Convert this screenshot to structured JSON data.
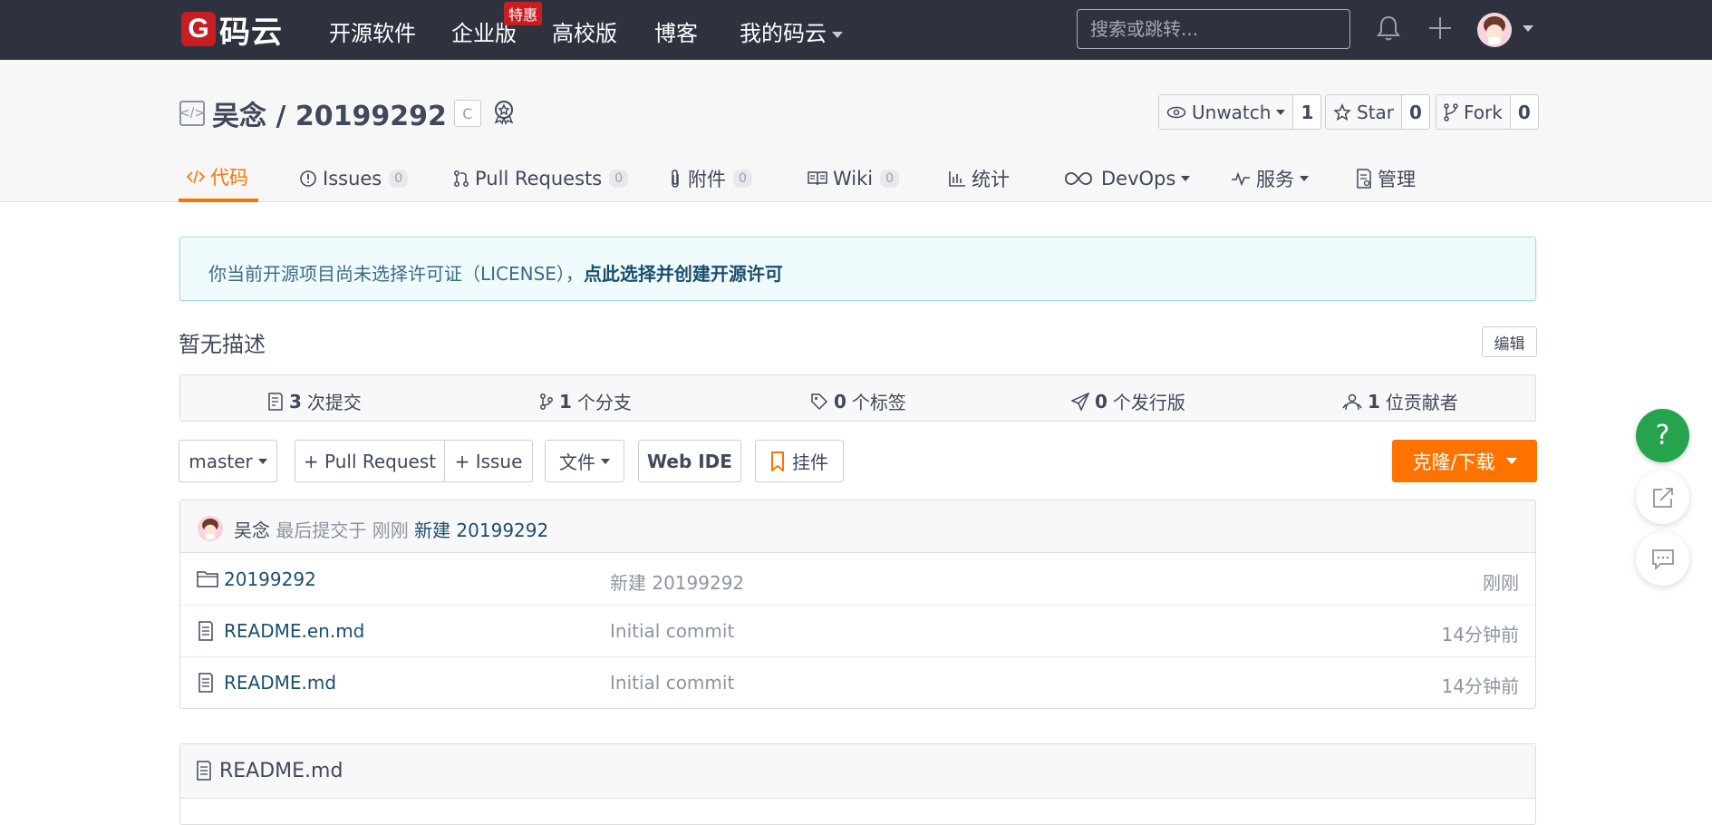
{
  "topnav": {
    "logo_text": "码云",
    "items": [
      "开源软件",
      "企业版",
      "高校版",
      "博客",
      "我的码云"
    ],
    "badge": "特惠",
    "search_placeholder": "搜索或跳转..."
  },
  "repo": {
    "title": "吴念 / 20199292",
    "lang_badge": "C",
    "actions": [
      {
        "label": "Unwatch",
        "count": "1"
      },
      {
        "label": "Star",
        "count": "0"
      },
      {
        "label": "Fork",
        "count": "0"
      }
    ]
  },
  "tabs": [
    {
      "label": "代码",
      "count": ""
    },
    {
      "label": "Issues",
      "count": "0"
    },
    {
      "label": "Pull Requests",
      "count": "0"
    },
    {
      "label": "附件",
      "count": "0"
    },
    {
      "label": "Wiki",
      "count": "0"
    },
    {
      "label": "统计",
      "count": ""
    },
    {
      "label": "DevOps",
      "count": ""
    },
    {
      "label": "服务",
      "count": ""
    },
    {
      "label": "管理",
      "count": ""
    }
  ],
  "notice": {
    "text": "你当前开源项目尚未选择许可证（LICENSE），",
    "link": "点此选择并创建开源许可"
  },
  "description": "暂无描述",
  "edit_label": "编辑",
  "stats": [
    {
      "num": "3",
      "label": "次提交"
    },
    {
      "num": "1",
      "label": "个分支"
    },
    {
      "num": "0",
      "label": "个标签"
    },
    {
      "num": "0",
      "label": "个发行版"
    },
    {
      "num": "1",
      "label": "位贡献者"
    }
  ],
  "toolbar": {
    "branch": "master",
    "pull_request": "+ Pull Request",
    "issue": "+ Issue",
    "file": "文件",
    "web_ide": "Web IDE",
    "widget": "挂件",
    "clone": "克隆/下载"
  },
  "commit": {
    "author": "吴念",
    "middle": "最后提交于",
    "time": "刚刚",
    "message": "新建 20199292"
  },
  "files": [
    {
      "name": "20199292",
      "message": "新建 20199292",
      "time": "刚刚",
      "type": "folder"
    },
    {
      "name": "README.en.md",
      "message": "Initial commit",
      "time": "14分钟前",
      "type": "file"
    },
    {
      "name": "README.md",
      "message": "Initial commit",
      "time": "14分钟前",
      "type": "file"
    }
  ],
  "readme_title": "README.md",
  "float": {
    "help": "?"
  },
  "colors": {
    "accent": "#fe7300",
    "nav_bg": "#2e323e",
    "brand_red": "#c71d23",
    "help_green": "#26a44d"
  }
}
